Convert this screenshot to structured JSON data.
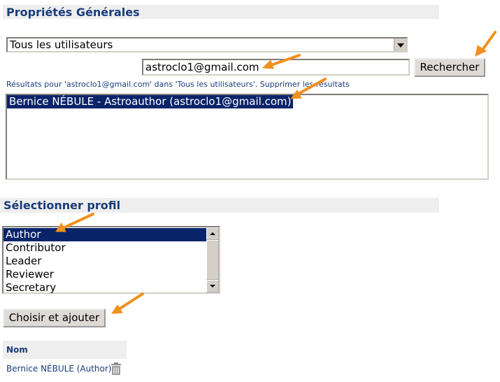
{
  "general": {
    "title": "Propriétés Générales",
    "user_scope_selected": "Tous les utilisateurs",
    "search_value": "astroclo1@gmail.com",
    "search_button": "Rechercher",
    "results_text": "Résultats pour 'astroclo1@gmail.com' dans 'Tous les utilisateurs'.",
    "clear_results_link": "Supprimer les résultats",
    "results": [
      "Bernice NÉBULE - Astroauthor (astroclo1@gmail.com)"
    ]
  },
  "profile": {
    "title": "Sélectionner profil",
    "options": [
      "Author",
      "Contributor",
      "Leader",
      "Reviewer",
      "Secretary"
    ],
    "selected": "Author",
    "add_button": "Choisir et ajouter"
  },
  "table": {
    "header": "Nom",
    "rows": [
      "Bernice NÉBULE (Author)"
    ]
  },
  "colors": {
    "accent": "#1a3c7a",
    "selection": "#0a246a",
    "annotation_arrow": "#f0901e"
  }
}
